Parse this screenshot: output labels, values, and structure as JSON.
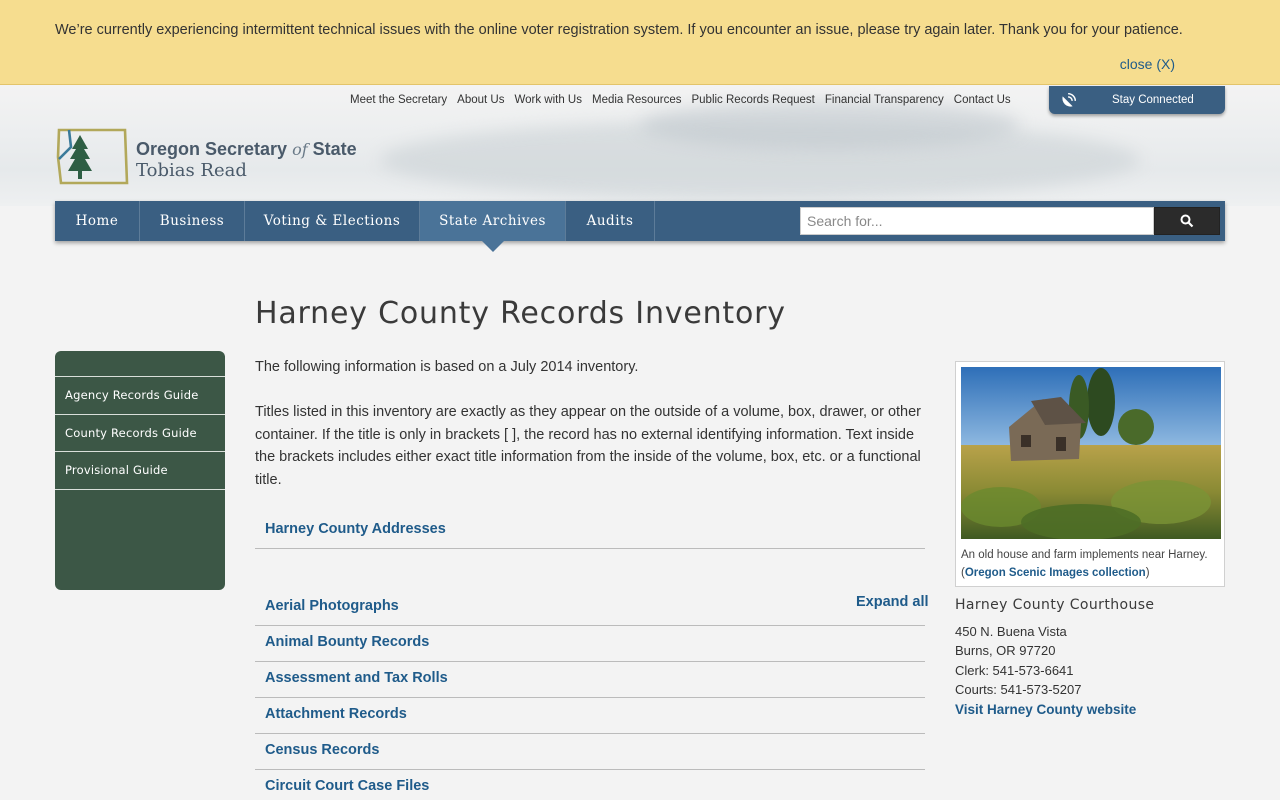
{
  "alert": {
    "message": "We’re currently experiencing intermittent technical issues with the online voter registration system. If you encounter an issue, please try again later. Thank you for your patience.",
    "close_label": "close (X)"
  },
  "utility_nav": [
    "Meet the Secretary",
    "About Us",
    "Work with Us",
    "Media Resources",
    "Public Records Request",
    "Financial Transparency",
    "Contact Us"
  ],
  "stay_connected": {
    "label": "Stay Connected",
    "icon": "satellite-dish-icon"
  },
  "logo": {
    "title": "Oregon Secretary",
    "of": "of",
    "state": "State",
    "subtitle": "Tobias Read"
  },
  "main_nav": [
    {
      "label": "Home",
      "active": false
    },
    {
      "label": "Business",
      "active": false
    },
    {
      "label": "Voting & Elections",
      "active": false
    },
    {
      "label": "State Archives",
      "active": true
    },
    {
      "label": "Audits",
      "active": false
    }
  ],
  "search": {
    "placeholder": "Search for...",
    "icon": "search-icon"
  },
  "page": {
    "title": "Harney County Records Inventory",
    "intro": "The following information is based on a July 2014 inventory.",
    "titles_note": "Titles listed in this inventory are exactly as they appear on the outside of a volume, box, drawer, or other container. If the title is only in brackets [ ], the record has no external identifying information. Text inside the brackets includes either exact title information from the inside of the volume, box, etc. or a functional title."
  },
  "sidebar": [
    "Agency Records Guide",
    "County Records Guide",
    "Provisional Guide"
  ],
  "addresses_link": "Harney County Addresses",
  "expand_all": "Expand all",
  "records": [
    "Aerial Photographs",
    "Animal Bounty Records",
    "Assessment and Tax Rolls",
    "Attachment Records",
    "Census Records",
    "Circuit Court Case Files"
  ],
  "figure": {
    "caption": "An old house and farm implements near Harney.",
    "link": "Oregon Scenic Images collection"
  },
  "courthouse": {
    "title": "Harney County Courthouse",
    "street": "450 N. Buena Vista",
    "city": "Burns, OR 97720",
    "clerk": "Clerk: 541-573-6641",
    "courts": "Courts: 541-573-5207",
    "website_link": "Visit Harney County website"
  },
  "colors": {
    "nav": "#3a5f82",
    "sidebar": "#3c5746",
    "link": "#1f5b8a",
    "alert": "#f6dd8f"
  }
}
